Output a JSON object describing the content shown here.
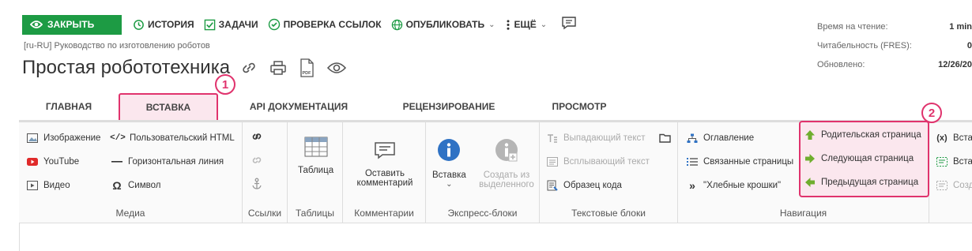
{
  "toolbar": {
    "close_label": "ЗАКРЫТЬ",
    "history_label": "ИСТОРИЯ",
    "tasks_label": "ЗАДАЧИ",
    "linkcheck_label": "ПРОВЕРКА ССЫЛОК",
    "publish_label": "ОПУБЛИКОВАТЬ",
    "more_label": "ЕЩЁ"
  },
  "breadcrumb": "[ru-RU] Руководство по изготовлению роботов",
  "page_title": "Простая робототехника",
  "meta": [
    {
      "label": "Время на чтение:",
      "value": "1 min"
    },
    {
      "label": "Читабельность (FRES):",
      "value": "0"
    },
    {
      "label": "Обновлено:",
      "value": "12/26/20"
    }
  ],
  "tabs": [
    {
      "label": "ГЛАВНАЯ"
    },
    {
      "label": "ВСТАВКА"
    },
    {
      "label": "API ДОКУМЕНТАЦИЯ"
    },
    {
      "label": "РЕЦЕНЗИРОВАНИЕ"
    },
    {
      "label": "ПРОСМОТР"
    }
  ],
  "active_tab": "ВСТАВКА",
  "callouts": [
    "1",
    "2"
  ],
  "ribbon": {
    "media": {
      "label": "Медиа",
      "items": [
        "Изображение",
        "YouTube",
        "Видео",
        "Пользовательский HTML",
        "Горизонтальная линия",
        "Символ"
      ]
    },
    "links": {
      "label": "Ссылки"
    },
    "tables": {
      "label": "Таблицы",
      "item": "Таблица"
    },
    "comments": {
      "label": "Комментарии",
      "item_line1": "Оставить",
      "item_line2": "комментарий"
    },
    "express": {
      "label": "Экспресс-блоки",
      "insert": "Вставка",
      "create_line1": "Создать из",
      "create_line2": "выделенного"
    },
    "text_blocks": {
      "label": "Текстовые блоки",
      "items": [
        "Выпадающий текст",
        "Всплывающий текст",
        "Образец кода"
      ]
    },
    "navigation": {
      "label": "Навигация",
      "items": [
        "Оглавление",
        "Связанные страницы",
        "\"Хлебные крошки\"",
        "Родительская страница",
        "Следующая страница",
        "Предыдущая страница"
      ]
    },
    "cut": {
      "items": [
        "Вста",
        "Вста",
        "Созд"
      ]
    }
  },
  "colors": {
    "accent": "#1d9b44",
    "highlight": "#e0336d",
    "highlight_bg": "#fbe7ee"
  }
}
